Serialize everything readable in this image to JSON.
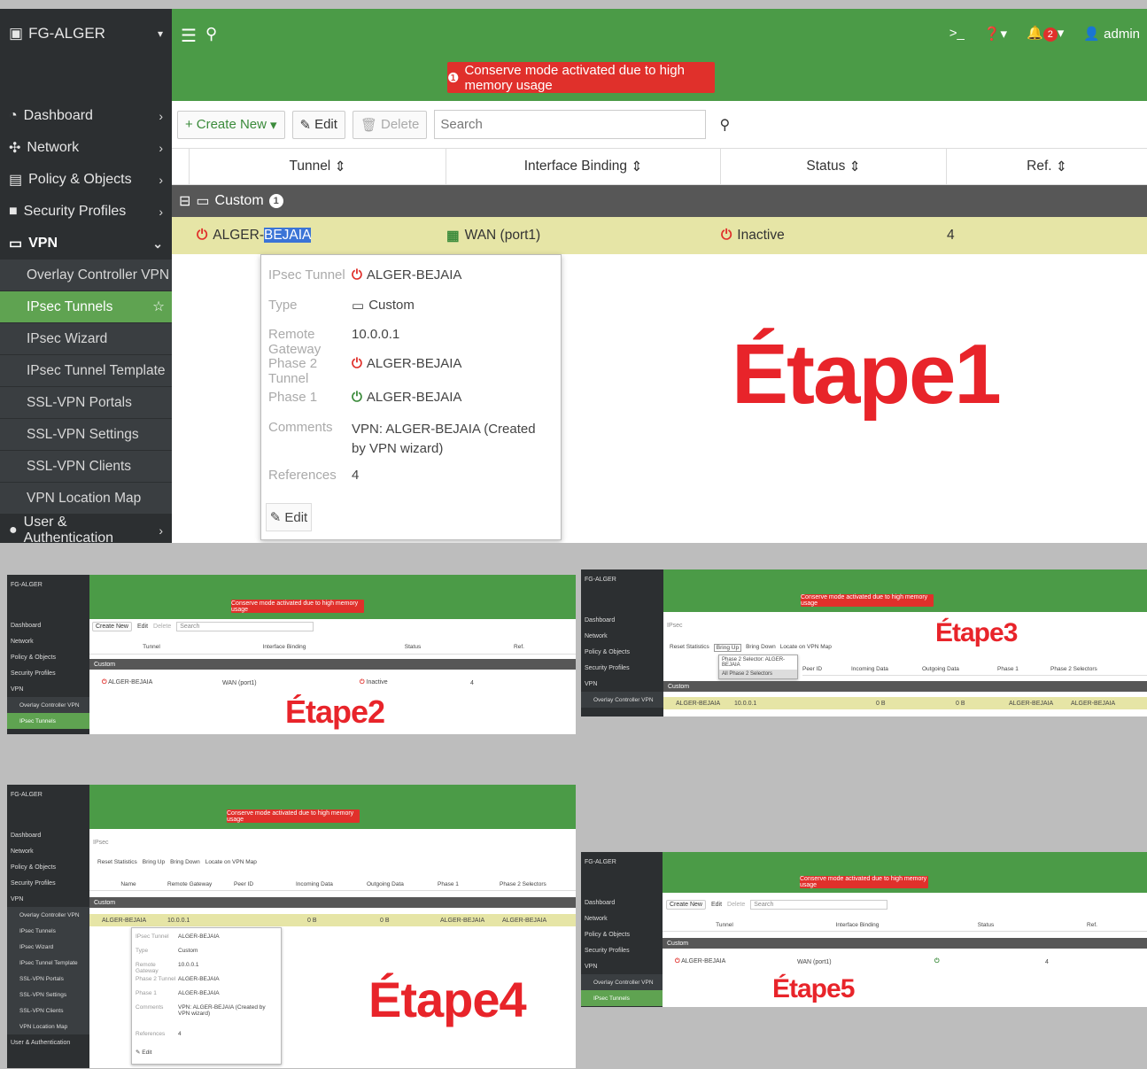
{
  "app": {
    "device_name": "FG-ALGER",
    "user": "admin",
    "notification_count": "2"
  },
  "banner": {
    "warning": "Conserve mode activated due to high memory usage"
  },
  "sidebar": {
    "items": [
      {
        "label": "Dashboard"
      },
      {
        "label": "Network"
      },
      {
        "label": "Policy & Objects"
      },
      {
        "label": "Security Profiles"
      },
      {
        "label": "VPN"
      },
      {
        "label": "User & Authentication"
      }
    ],
    "vpn_sub": [
      {
        "label": "Overlay Controller VPN"
      },
      {
        "label": "IPsec Tunnels"
      },
      {
        "label": "IPsec Wizard"
      },
      {
        "label": "IPsec Tunnel Template"
      },
      {
        "label": "SSL-VPN Portals"
      },
      {
        "label": "SSL-VPN Settings"
      },
      {
        "label": "SSL-VPN Clients"
      },
      {
        "label": "VPN Location Map"
      }
    ]
  },
  "toolbar": {
    "create_new": "Create New",
    "edit": "Edit",
    "delete": "Delete",
    "search_placeholder": "Search"
  },
  "table": {
    "columns": [
      "Tunnel",
      "Interface Binding",
      "Status",
      "Ref."
    ],
    "group": {
      "label": "Custom",
      "count": "1"
    },
    "rows": [
      {
        "tunnel_prefix": "ALGER-",
        "tunnel_selected": "BEJAIA",
        "interface": "WAN (port1)",
        "status": "Inactive",
        "ref": "4"
      }
    ]
  },
  "tooltip": {
    "rows": [
      {
        "label": "IPsec Tunnel",
        "value": "ALGER-BEJAIA"
      },
      {
        "label": "Type",
        "value": "Custom"
      },
      {
        "label": "Remote Gateway",
        "value": "10.0.0.1"
      },
      {
        "label": "Phase 2 Tunnel",
        "value": "ALGER-BEJAIA"
      },
      {
        "label": "Phase 1",
        "value": "ALGER-BEJAIA"
      },
      {
        "label": "Comments",
        "value": "VPN: ALGER-BEJAIA (Created by VPN wizard)"
      },
      {
        "label": "References",
        "value": "4"
      }
    ],
    "edit": "Edit"
  },
  "steps": {
    "step1": "Étape1",
    "step2": "Étape2",
    "step3": "Étape3",
    "step4": "Étape4",
    "step5": "Étape5"
  },
  "monitor": {
    "search": "IPsec",
    "buttons": [
      "Reset Statistics",
      "Bring Up",
      "Bring Down",
      "Locate on VPN Map"
    ],
    "columns": [
      "Name",
      "Remote Gateway",
      "Peer ID",
      "Incoming Data",
      "Outgoing Data",
      "Phase 1",
      "Phase 2 Selectors"
    ],
    "row": {
      "name": "ALGER-BEJAIA",
      "gateway": "10.0.0.1",
      "incoming": "0 B",
      "outgoing": "0 B",
      "phase1": "ALGER-BEJAIA",
      "phase2": "ALGER-BEJAIA"
    },
    "dropdown": [
      "Phase 2 Selector: ALGER-BEJAIA",
      "All Phase 2 Selectors"
    ]
  },
  "colors": {
    "accent_green": "#4b9b47",
    "alert_red": "#e0302b",
    "row_highlight": "#e6e5a6",
    "step_red": "#e8242a"
  }
}
